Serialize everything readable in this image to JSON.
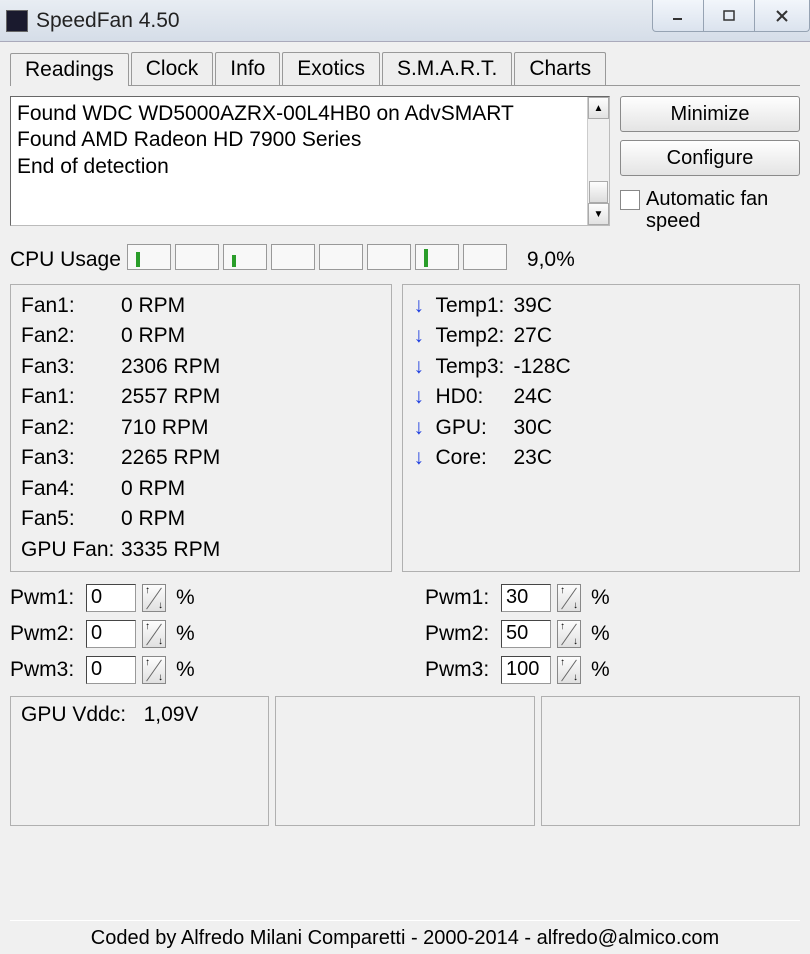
{
  "window": {
    "title": "SpeedFan 4.50"
  },
  "tabs": [
    "Readings",
    "Clock",
    "Info",
    "Exotics",
    "S.M.A.R.T.",
    "Charts"
  ],
  "active_tab": 0,
  "log": "Found WDC WD5000AZRX-00L4HB0 on AdvSMART\nFound AMD Radeon HD 7900 Series\nEnd of detection",
  "buttons": {
    "minimize": "Minimize",
    "configure": "Configure"
  },
  "auto_fan": {
    "label": "Automatic fan speed",
    "checked": false
  },
  "cpu": {
    "label": "CPU Usage",
    "bars": [
      15,
      0,
      12,
      0,
      0,
      0,
      18,
      0
    ],
    "pct": "9,0%"
  },
  "fans": [
    {
      "name": "Fan1:",
      "rpm": "0 RPM"
    },
    {
      "name": "Fan2:",
      "rpm": "0 RPM"
    },
    {
      "name": "Fan3:",
      "rpm": "2306 RPM"
    },
    {
      "name": "Fan1:",
      "rpm": "2557 RPM"
    },
    {
      "name": "Fan2:",
      "rpm": "710 RPM"
    },
    {
      "name": "Fan3:",
      "rpm": "2265 RPM"
    },
    {
      "name": "Fan4:",
      "rpm": "0 RPM"
    },
    {
      "name": "Fan5:",
      "rpm": "0 RPM"
    },
    {
      "name": "GPU Fan:",
      "rpm": "3335 RPM"
    }
  ],
  "temps": [
    {
      "name": "Temp1:",
      "val": "39C",
      "dir": "down"
    },
    {
      "name": "Temp2:",
      "val": "27C",
      "dir": "down"
    },
    {
      "name": "Temp3:",
      "val": "-128C",
      "dir": "down"
    },
    {
      "name": "HD0:",
      "val": "24C",
      "dir": "down"
    },
    {
      "name": "GPU:",
      "val": "30C",
      "dir": "down"
    },
    {
      "name": "Core:",
      "val": "23C",
      "dir": "down"
    }
  ],
  "pwm_left": [
    {
      "label": "Pwm1:",
      "value": "0"
    },
    {
      "label": "Pwm2:",
      "value": "0"
    },
    {
      "label": "Pwm3:",
      "value": "0"
    }
  ],
  "pwm_right": [
    {
      "label": "Pwm1:",
      "value": "30"
    },
    {
      "label": "Pwm2:",
      "value": "50"
    },
    {
      "label": "Pwm3:",
      "value": "100"
    }
  ],
  "voltage": {
    "label": "GPU Vddc:",
    "value": "1,09V"
  },
  "footer": "Coded by Alfredo Milani Comparetti - 2000-2014 - alfredo@almico.com"
}
